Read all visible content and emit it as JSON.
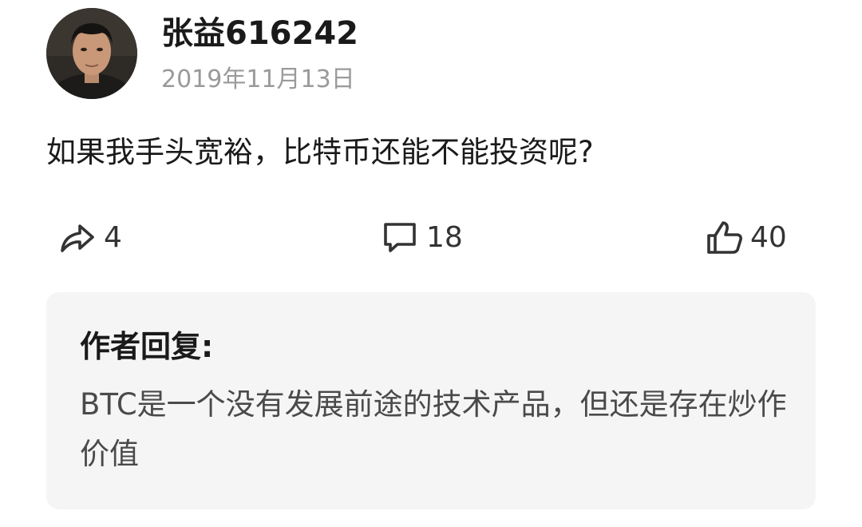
{
  "post": {
    "author": {
      "name": "张益616242",
      "avatar_icon": "person-photo-avatar"
    },
    "date": "2019年11月13日",
    "text": "如果我手头宽裕，比特币还能不能投资呢?"
  },
  "actions": {
    "share": {
      "icon": "share-arrow-icon",
      "count": "4"
    },
    "comment": {
      "icon": "comment-bubble-icon",
      "count": "18"
    },
    "like": {
      "icon": "thumbs-up-icon",
      "count": "40"
    }
  },
  "reply": {
    "label": "作者回复:",
    "text": "BTC是一个没有发展前途的技术产品，但还是存在炒作价值"
  },
  "colors": {
    "text_primary": "#1a1a1a",
    "text_secondary": "#9a9a9a",
    "reply_background": "#f5f5f5",
    "reply_text": "#4a4a4a"
  }
}
